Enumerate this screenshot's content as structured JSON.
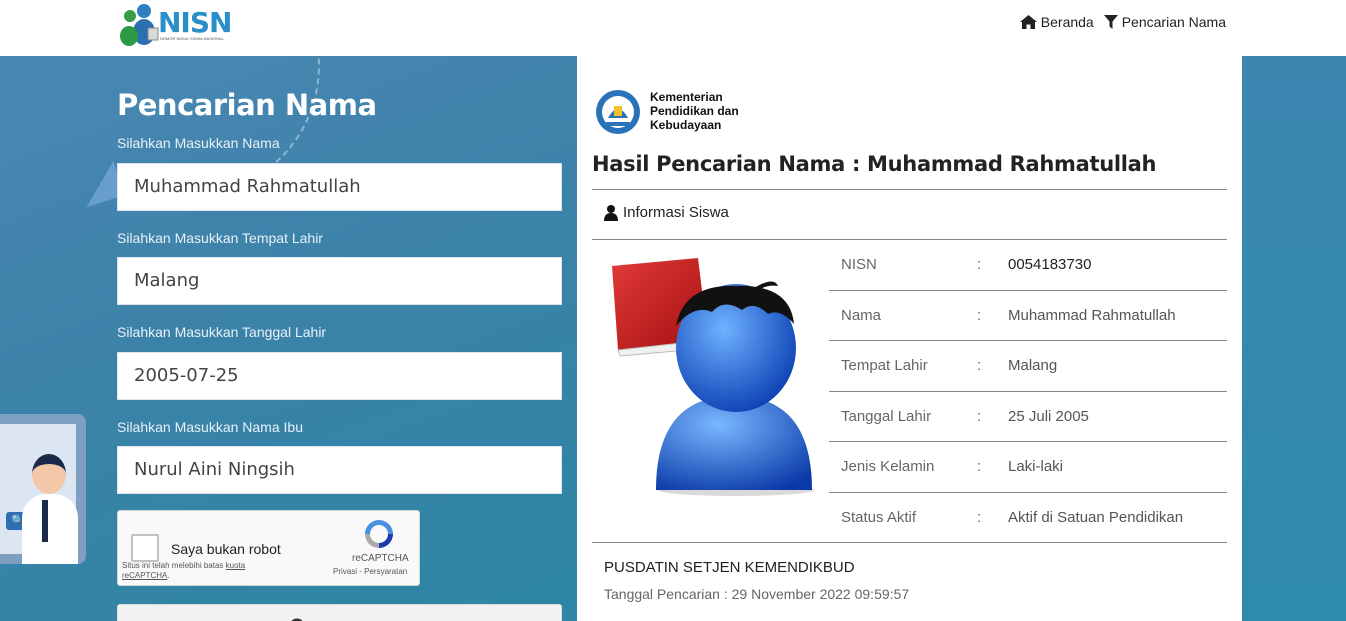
{
  "navbar": {
    "logo_text": "NISN",
    "logo_subtitle": "NOMOR INDUK SISWA NASIONAL",
    "links": [
      {
        "label": "Beranda",
        "icon": "home-icon"
      },
      {
        "label": "Pencarian Nama",
        "icon": "filter-icon"
      }
    ]
  },
  "form": {
    "title": "Pencarian Nama",
    "fields": [
      {
        "label": "Silahkan Masukkan Nama",
        "value": "Muhammad Rahmatullah"
      },
      {
        "label": "Silahkan Masukkan Tempat Lahir",
        "value": "Malang"
      },
      {
        "label": "Silahkan Masukkan Tanggal Lahir",
        "value": "2005-07-25"
      },
      {
        "label": "Silahkan Masukkan Nama Ibu",
        "value": "Nurul Aini Ningsih"
      }
    ],
    "recaptcha": {
      "label": "Saya bukan robot",
      "brand": "reCAPTCHA",
      "terms": "Privasi - Persyaratan",
      "note_prefix": "Situs ini telah melebihi batas",
      "note_link": "kuota reCAPTCHA",
      "note_suffix": "."
    }
  },
  "result": {
    "ministry": {
      "line1": "Kementerian",
      "line2": "Pendidikan dan",
      "line3": "Kebudayaan"
    },
    "title": "Hasil Pencarian Nama : Muhammad Rahmatullah",
    "tab_label": "Informasi Siswa",
    "separator": ":",
    "rows": [
      {
        "key": "NISN",
        "value": "0054183730"
      },
      {
        "key": "Nama",
        "value": "Muhammad Rahmatullah"
      },
      {
        "key": "Tempat Lahir",
        "value": "Malang"
      },
      {
        "key": "Tanggal Lahir",
        "value": "25 Juli 2005"
      },
      {
        "key": "Jenis Kelamin",
        "value": "Laki-laki"
      },
      {
        "key": "Status Aktif",
        "value": "Aktif di Satuan Pendidikan"
      }
    ],
    "footer_org": "PUSDATIN SETJEN KEMENDIKBUD",
    "footer_date": "Tanggal Pencarian : 29 November 2022 09:59:57"
  },
  "colors": {
    "panel_blue": "#3b82a8",
    "logo_blue": "#2a8ec9",
    "divider": "#888888"
  }
}
